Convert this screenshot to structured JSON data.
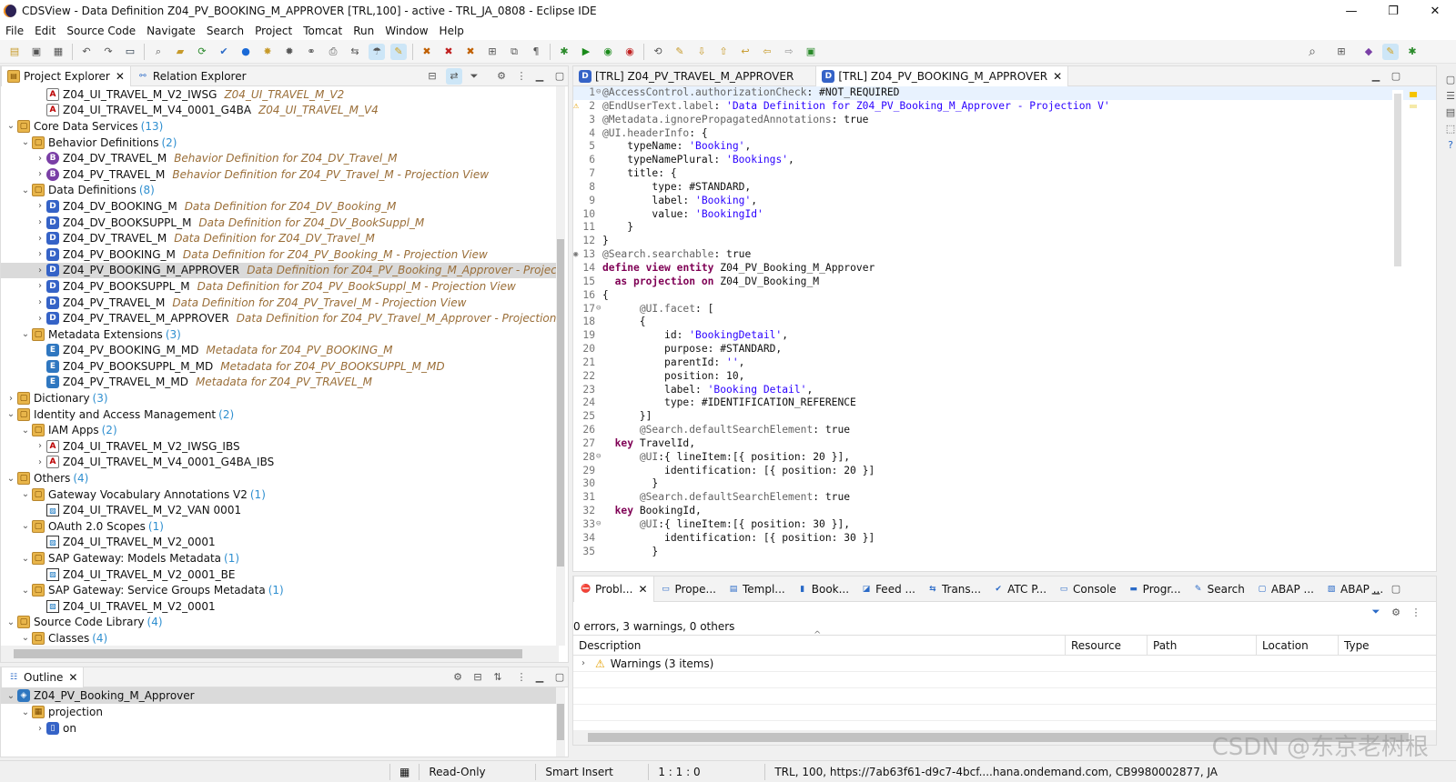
{
  "window": {
    "title": "CDSView - Data Definition Z04_PV_BOOKING_M_APPROVER [TRL,100] - active - TRL_JA_0808 - Eclipse IDE",
    "minimize": "—",
    "restore": "❐",
    "close": "✕"
  },
  "menu": [
    "File",
    "Edit",
    "Source Code",
    "Navigate",
    "Search",
    "Project",
    "Tomcat",
    "Run",
    "Window",
    "Help"
  ],
  "project_explorer": {
    "tab_label": "Project Explorer",
    "relation_tab_label": "Relation Explorer",
    "rows": [
      {
        "indent": 5,
        "icon": "A",
        "text": "Z04_UI_TRAVEL_M_V2_IWSG",
        "desc": "Z04_UI_TRAVEL_M_V2",
        "cnt": "",
        "tw": ""
      },
      {
        "indent": 5,
        "icon": "A",
        "text": "Z04_UI_TRAVEL_M_V4_0001_G4BA",
        "desc": "Z04_UI_TRAVEL_M_V4",
        "cnt": "",
        "tw": ""
      },
      {
        "indent": 3,
        "icon": "F",
        "text": "Core Data Services",
        "desc": "",
        "cnt": "(13)",
        "tw": "v"
      },
      {
        "indent": 4,
        "icon": "F",
        "text": "Behavior Definitions",
        "desc": "",
        "cnt": "(2)",
        "tw": "v"
      },
      {
        "indent": 5,
        "icon": "B",
        "text": "Z04_DV_TRAVEL_M",
        "desc": "Behavior Definition for Z04_DV_Travel_M",
        "cnt": "",
        "tw": ">"
      },
      {
        "indent": 5,
        "icon": "B",
        "text": "Z04_PV_TRAVEL_M",
        "desc": "Behavior Definition for Z04_PV_Travel_M - Projection View",
        "cnt": "",
        "tw": ">"
      },
      {
        "indent": 4,
        "icon": "F",
        "text": "Data Definitions",
        "desc": "",
        "cnt": "(8)",
        "tw": "v"
      },
      {
        "indent": 5,
        "icon": "D",
        "text": "Z04_DV_BOOKING_M",
        "desc": "Data Definition for Z04_DV_Booking_M",
        "cnt": "",
        "tw": ">"
      },
      {
        "indent": 5,
        "icon": "D",
        "text": "Z04_DV_BOOKSUPPL_M",
        "desc": "Data Definition for Z04_DV_BookSuppl_M",
        "cnt": "",
        "tw": ">"
      },
      {
        "indent": 5,
        "icon": "D",
        "text": "Z04_DV_TRAVEL_M",
        "desc": "Data Definition for Z04_DV_Travel_M",
        "cnt": "",
        "tw": ">"
      },
      {
        "indent": 5,
        "icon": "D",
        "text": "Z04_PV_BOOKING_M",
        "desc": "Data Definition for Z04_PV_Booking_M - Projection View",
        "cnt": "",
        "tw": ">"
      },
      {
        "indent": 5,
        "icon": "D",
        "text": "Z04_PV_BOOKING_M_APPROVER",
        "desc": "Data Definition for Z04_PV_Booking_M_Approver - Projectio",
        "cnt": "",
        "tw": ">",
        "sel": true
      },
      {
        "indent": 5,
        "icon": "D",
        "text": "Z04_PV_BOOKSUPPL_M",
        "desc": "Data Definition for Z04_PV_BookSuppl_M - Projection View",
        "cnt": "",
        "tw": ">"
      },
      {
        "indent": 5,
        "icon": "D",
        "text": "Z04_PV_TRAVEL_M",
        "desc": "Data Definition for Z04_PV_Travel_M - Projection View",
        "cnt": "",
        "tw": ">"
      },
      {
        "indent": 5,
        "icon": "D",
        "text": "Z04_PV_TRAVEL_M_APPROVER",
        "desc": "Data Definition for Z04_PV_Travel_M_Approver - Projection V",
        "cnt": "",
        "tw": ">"
      },
      {
        "indent": 4,
        "icon": "F",
        "text": "Metadata Extensions",
        "desc": "",
        "cnt": "(3)",
        "tw": "v"
      },
      {
        "indent": 5,
        "icon": "E",
        "text": "Z04_PV_BOOKING_M_MD",
        "desc": "Metadata for Z04_PV_BOOKING_M",
        "cnt": "",
        "tw": ""
      },
      {
        "indent": 5,
        "icon": "E",
        "text": "Z04_PV_BOOKSUPPL_M_MD",
        "desc": "Metadata for Z04_PV_BOOKSUPPL_M_MD",
        "cnt": "",
        "tw": ""
      },
      {
        "indent": 5,
        "icon": "E",
        "text": "Z04_PV_TRAVEL_M_MD",
        "desc": "Metadata for Z04_PV_TRAVEL_M",
        "cnt": "",
        "tw": ""
      },
      {
        "indent": 3,
        "icon": "F",
        "text": "Dictionary",
        "desc": "",
        "cnt": "(3)",
        "tw": ">"
      },
      {
        "indent": 3,
        "icon": "F",
        "text": "Identity and Access Management",
        "desc": "",
        "cnt": "(2)",
        "tw": "v"
      },
      {
        "indent": 4,
        "icon": "F",
        "text": "IAM Apps",
        "desc": "",
        "cnt": "(2)",
        "tw": "v"
      },
      {
        "indent": 5,
        "icon": "A",
        "text": "Z04_UI_TRAVEL_M_V2_IWSG_IBS",
        "desc": "",
        "cnt": "",
        "tw": ">"
      },
      {
        "indent": 5,
        "icon": "A",
        "text": "Z04_UI_TRAVEL_M_V4_0001_G4BA_IBS",
        "desc": "",
        "cnt": "",
        "tw": ">"
      },
      {
        "indent": 3,
        "icon": "F",
        "text": "Others",
        "desc": "",
        "cnt": "(4)",
        "tw": "v"
      },
      {
        "indent": 4,
        "icon": "F",
        "text": "Gateway Vocabulary Annotations V2",
        "desc": "",
        "cnt": "(1)",
        "tw": "v"
      },
      {
        "indent": 5,
        "icon": "G",
        "text": "Z04_UI_TRAVEL_M_V2_VAN          0001",
        "desc": "",
        "cnt": "",
        "tw": ""
      },
      {
        "indent": 4,
        "icon": "F",
        "text": "OAuth 2.0 Scopes",
        "desc": "",
        "cnt": "(1)",
        "tw": "v"
      },
      {
        "indent": 5,
        "icon": "G",
        "text": "Z04_UI_TRAVEL_M_V2_0001",
        "desc": "",
        "cnt": "",
        "tw": ""
      },
      {
        "indent": 4,
        "icon": "F",
        "text": "SAP Gateway: Models Metadata",
        "desc": "",
        "cnt": "(1)",
        "tw": "v"
      },
      {
        "indent": 5,
        "icon": "G",
        "text": "Z04_UI_TRAVEL_M_V2_0001_BE",
        "desc": "",
        "cnt": "",
        "tw": ""
      },
      {
        "indent": 4,
        "icon": "F",
        "text": "SAP Gateway: Service Groups Metadata",
        "desc": "",
        "cnt": "(1)",
        "tw": "v"
      },
      {
        "indent": 5,
        "icon": "G",
        "text": "Z04_UI_TRAVEL_M_V2_0001",
        "desc": "",
        "cnt": "",
        "tw": ""
      },
      {
        "indent": 3,
        "icon": "F",
        "text": "Source Code Library",
        "desc": "",
        "cnt": "(4)",
        "tw": "v"
      },
      {
        "indent": 4,
        "icon": "F",
        "text": "Classes",
        "desc": "",
        "cnt": "(4)",
        "tw": "v"
      }
    ]
  },
  "outline": {
    "tab_label": "Outline",
    "rows": [
      {
        "indent": 0,
        "icon": "P",
        "text": "Z04_PV_Booking_M_Approver",
        "tw": "v",
        "sel": true
      },
      {
        "indent": 1,
        "icon": "T",
        "text": "projection",
        "tw": "v"
      },
      {
        "indent": 2,
        "icon": "O",
        "text": "on",
        "tw": ">"
      }
    ]
  },
  "editor": {
    "tabs": [
      "[TRL] Z04_PV_TRAVEL_M_APPROVER",
      "[TRL] Z04_PV_BOOKING_M_APPROVER"
    ],
    "lines": [
      "@AccessControl.authorizationCheck: #NOT_REQUIRED",
      "@EndUserText.label: 'Data Definition for Z04_PV_Booking_M_Approver - Projection V'",
      "@Metadata.ignorePropagatedAnnotations: true",
      "@UI.headerInfo: {",
      "    typeName: 'Booking',",
      "    typeNamePlural: 'Bookings',",
      "    title: {",
      "        type: #STANDARD,",
      "        label: 'Booking',",
      "        value: 'BookingId'",
      "    }",
      "}",
      "@Search.searchable: true",
      "define view entity Z04_PV_Booking_M_Approver",
      "  as projection on Z04_DV_Booking_M",
      "{",
      "      @UI.facet: [",
      "      {",
      "          id: 'BookingDetail',",
      "          purpose: #STANDARD,",
      "          parentId: '',",
      "          position: 10,",
      "          label: 'Booking Detail',",
      "          type: #IDENTIFICATION_REFERENCE",
      "      }]",
      "      @Search.defaultSearchElement: true",
      "  key TravelId,",
      "      @UI:{ lineItem:[{ position: 20 }],",
      "          identification: [{ position: 20 }]",
      "        }",
      "      @Search.defaultSearchElement: true",
      "  key BookingId,",
      "      @UI:{ lineItem:[{ position: 30 }],",
      "          identification: [{ position: 30 }]",
      "        }"
    ]
  },
  "problems": {
    "tabs": [
      "Probl...",
      "Prope...",
      "Templ...",
      "Book...",
      "Feed ...",
      "Trans...",
      "ATC P...",
      "Console",
      "Progr...",
      "Search",
      "ABAP ...",
      "ABAP ..."
    ],
    "summary": "0 errors, 3 warnings, 0 others",
    "columns": [
      "Description",
      "Resource",
      "Path",
      "Location",
      "Type"
    ],
    "warning_row": "Warnings (3 items)"
  },
  "status": {
    "mode": "Read-Only",
    "insert": "Smart Insert",
    "pos": "1 : 1 : 0",
    "conn": "TRL, 100, https://7ab63f61-d9c7-4bcf....hana.ondemand.com, CB9980002877, JA"
  },
  "watermark": "CSDN @东京老树根"
}
